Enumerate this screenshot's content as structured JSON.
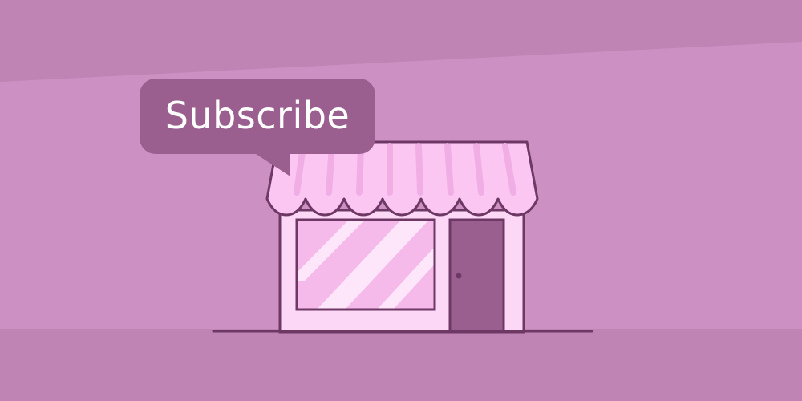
{
  "subscribe": {
    "label": "Subscribe"
  },
  "colors": {
    "background_top": "#bf84b4",
    "background_mid": "#cc90c2",
    "floor": "#bf84b4",
    "outline": "#6e3865",
    "awning": "#fcc6f2",
    "shop_wall": "#fcd8f6",
    "window_glass": "#f5b9ea",
    "door": "#9b5f8f",
    "bubble": "#9b5f8f",
    "bubble_text": "#ffffff"
  },
  "icons": {
    "illustration": "storefront-icon"
  }
}
